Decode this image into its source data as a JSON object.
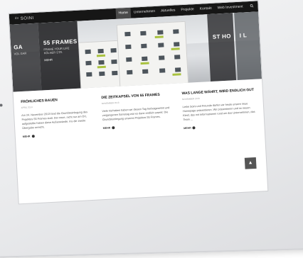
{
  "nav": {
    "logo": "ᵈᵒ SOINI",
    "items": [
      "Home",
      "Unternehmen",
      "Aktuelles",
      "Projekte",
      "Kontakt",
      "Web Investment"
    ],
    "active_index": 0,
    "search_icon": "search-icon"
  },
  "hero": {
    "left_title": "GA",
    "left_sub": "VOL GAR",
    "center_title": "55 FRAMES",
    "center_sub": "FRAME YOUR LIFE KÖLNER STR.",
    "center_tag": "MEHR",
    "right_title": "ST HO",
    "right_far": "I L"
  },
  "articles": [
    {
      "title": "FRÖHLICHES BAUEN",
      "meta": "APRIL 2014",
      "body": "Am 24. November 2013 fand die Grundsteinlegung des Projektes 55 Frames statt. Der neue, nicht nur am Ort, aufgestellte haben diese Außenwände. Ins die zweite Übergabe erreicht.",
      "more": "MEHR"
    },
    {
      "title": "DIE ZEITKAPSEL VON 55 FRAMES",
      "meta": "NOVEMBER 2013",
      "body": "Viele Vorhaben haben wir diesen Tag herbeigesehnt und vergangenen Samstag war es dann endlich soweit: Die Grundsteinlegung unseres Projektes 55 Frames.",
      "more": "MEHR"
    },
    {
      "title": "WAS LANGE WÄHRT, WIRD ENDLICH GUT",
      "meta": "NOVEMBER 2013",
      "body": "Liebe Soini und Freunde dürfen wir heute unsere neue Homepage präsentieren. Wir präsentieren und im neuen Kleid, das mit Informationen rund um das Unternehmen, das Team ...",
      "more": "MEHR"
    }
  ],
  "scroll_top_label": "▲",
  "colors": {
    "nav_bg": "#161616",
    "accent_green": "#a9c23f"
  }
}
